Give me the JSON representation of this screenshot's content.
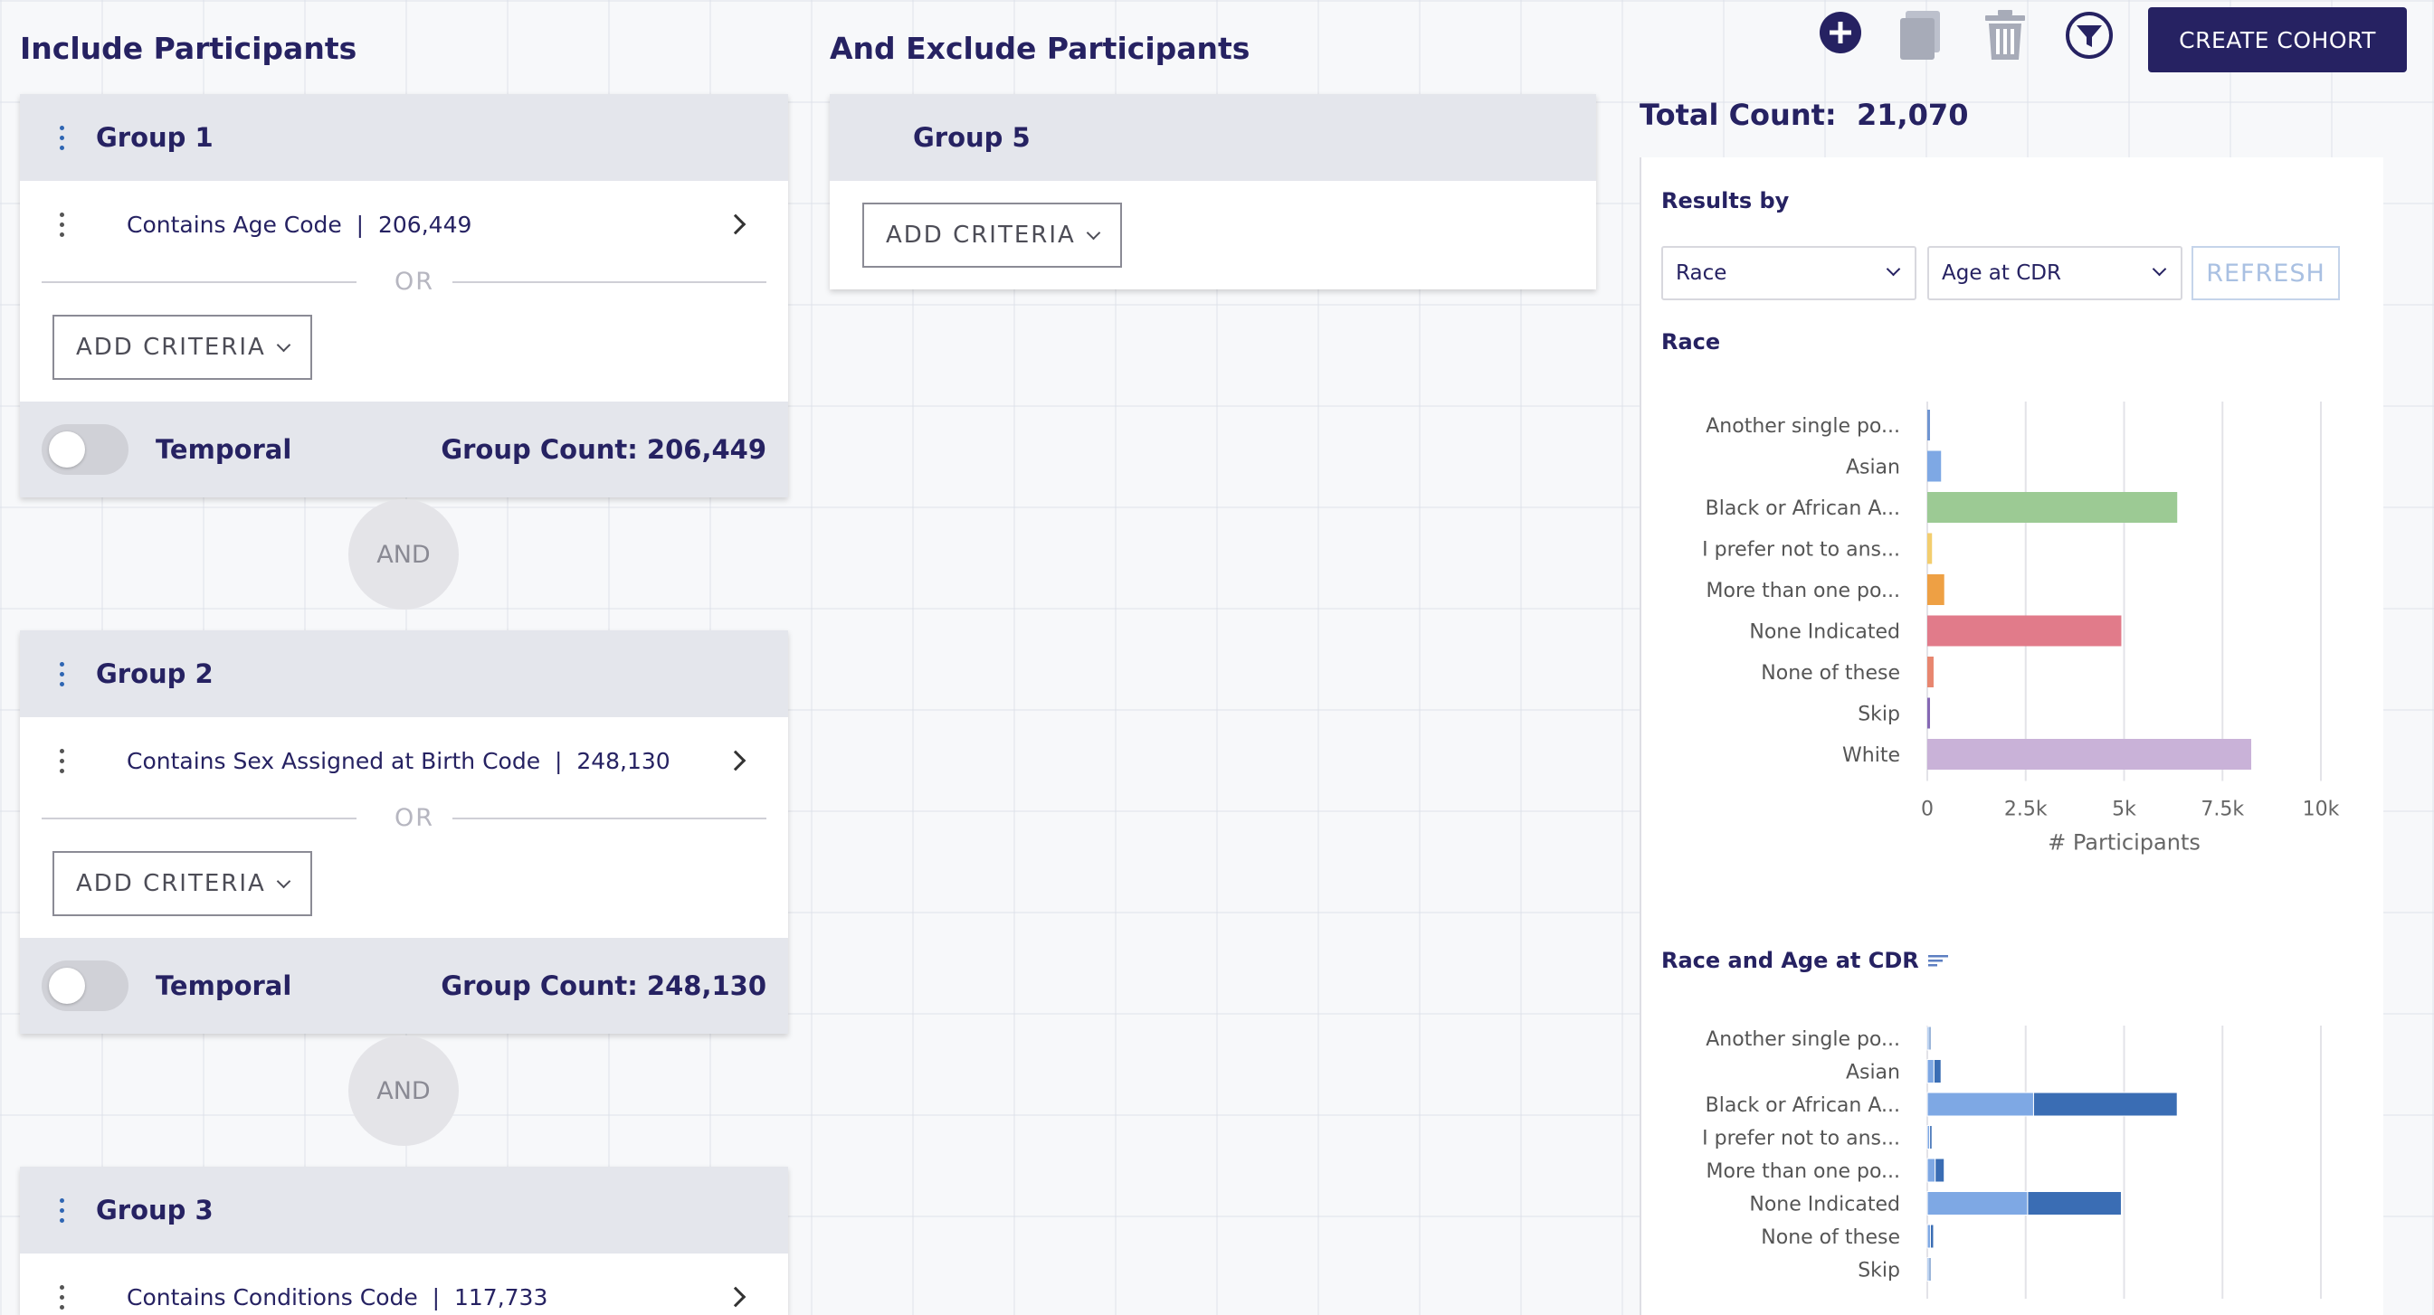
{
  "include": {
    "title": "Include Participants",
    "groups": [
      {
        "title": "Group 1",
        "criteria": [
          {
            "label": "Contains Age Code",
            "count": "206,449"
          }
        ],
        "or_label": "OR",
        "add_label": "ADD CRITERIA",
        "temporal_label": "Temporal",
        "group_count": "Group Count: 206,449"
      },
      {
        "title": "Group 2",
        "criteria": [
          {
            "label": "Contains Sex Assigned at Birth Code",
            "count": "248,130"
          }
        ],
        "or_label": "OR",
        "add_label": "ADD CRITERIA",
        "temporal_label": "Temporal",
        "group_count": "Group Count: 248,130"
      },
      {
        "title": "Group 3",
        "criteria": [
          {
            "label": "Contains Conditions Code",
            "count": "117,733"
          }
        ]
      }
    ],
    "and_label": "AND"
  },
  "exclude": {
    "title": "And Exclude Participants",
    "group": {
      "title": "Group 5",
      "add_label": "ADD CRITERIA"
    }
  },
  "toolbar": {
    "icons": [
      "plus-circle-icon",
      "copy-icon",
      "trash-icon",
      "filter-icon"
    ],
    "create_label": "CREATE COHORT"
  },
  "results": {
    "total_label": "Total Count:",
    "total_value": "21,070",
    "results_by_label": "Results by",
    "select1": "Race",
    "select2": "Age at CDR",
    "refresh_label": "REFRESH",
    "colors": {
      "primary": "#262262",
      "link": "#2f66b3"
    }
  },
  "chart_data": [
    {
      "type": "bar",
      "orientation": "horizontal",
      "title": "Race",
      "categories": [
        "Another single po...",
        "Asian",
        "Black or African A...",
        "I prefer not to ans...",
        "More than one po...",
        "None Indicated",
        "None of these",
        "Skip",
        "White"
      ],
      "values": [
        50,
        350,
        6350,
        120,
        430,
        4930,
        160,
        60,
        8230
      ],
      "colors": [
        "#6f95d1",
        "#7ea8e4",
        "#9cca94",
        "#f3ce6e",
        "#eea044",
        "#e17b8a",
        "#e8866f",
        "#8568b4",
        "#c9b2d8"
      ],
      "xlabel": "# Participants",
      "xticks": [
        "0",
        "2.5k",
        "5k",
        "7.5k",
        "10k"
      ],
      "xlim": [
        0,
        10000
      ],
      "grid": true
    },
    {
      "type": "bar",
      "orientation": "horizontal",
      "stacked": true,
      "title": "Race and Age at CDR",
      "categories": [
        "Another single po...",
        "Asian",
        "Black or African A...",
        "I prefer not to ans...",
        "More than one po...",
        "None Indicated",
        "None of these",
        "Skip"
      ],
      "series": [
        {
          "values": [
            30,
            170,
            2700,
            60,
            200,
            2550,
            80,
            30
          ],
          "color": "#7ea8e4"
        },
        {
          "values": [
            20,
            180,
            3650,
            60,
            230,
            2380,
            80,
            30
          ],
          "color": "#3a6db4"
        }
      ],
      "xlim": [
        0,
        10000
      ],
      "grid": true
    }
  ]
}
